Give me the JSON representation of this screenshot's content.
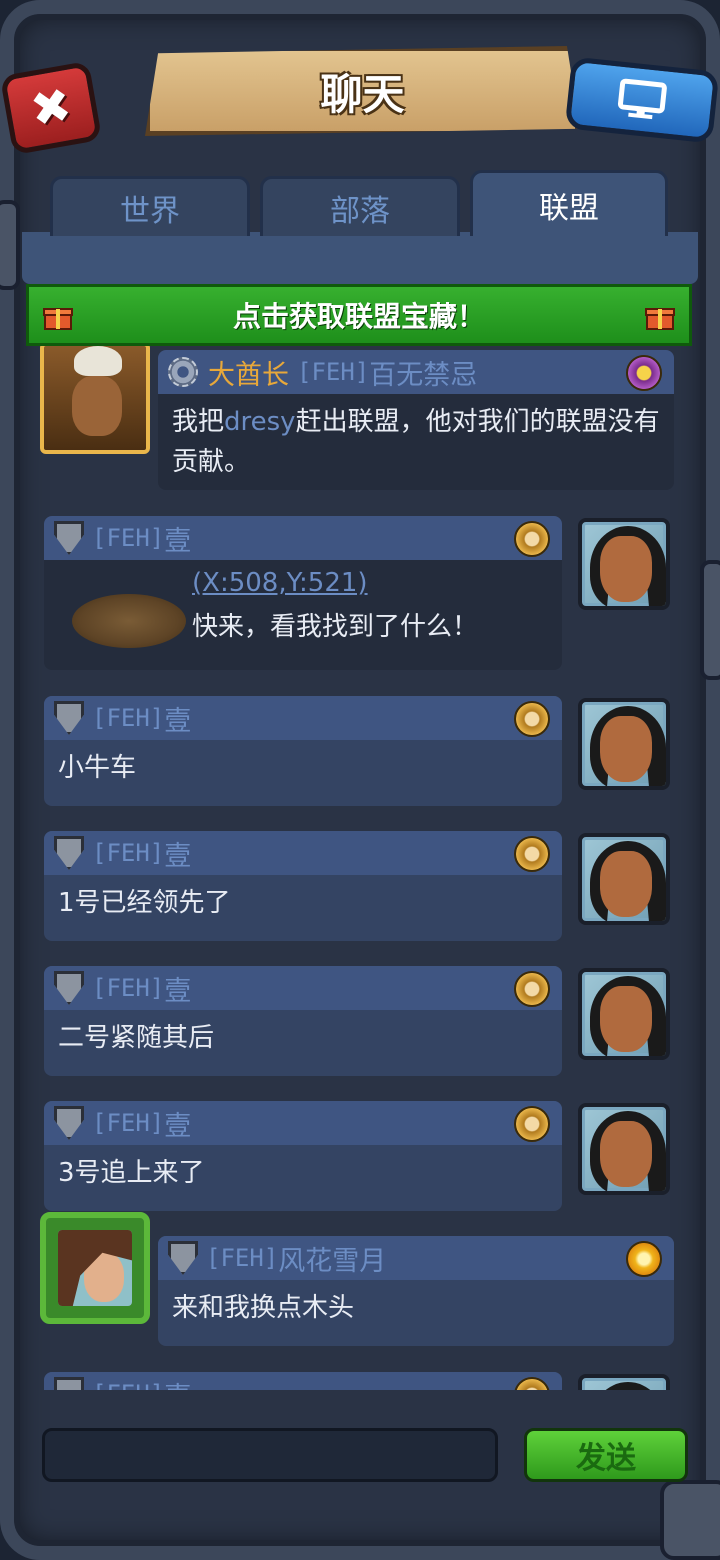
{
  "header": {
    "title": "聊天",
    "close_icon": "close-icon",
    "screen_icon": "monitor-icon"
  },
  "tabs": [
    {
      "label": "世界",
      "active": false
    },
    {
      "label": "部落",
      "active": false
    },
    {
      "label": "联盟",
      "active": true
    }
  ],
  "treasure_banner": {
    "text": "点击获取联盟宝藏！",
    "icon": "gift-icon"
  },
  "messages": [
    {
      "role": "大酋长",
      "tag": "[FEH]",
      "name": "百无禁忌",
      "text_before": "我把",
      "highlight": "dresy",
      "text_after": "赶出联盟，他对我们的联盟没有贡献。"
    },
    {
      "tag": "[FEH]",
      "name": "壹",
      "coord": "(X:508,Y:521)",
      "text": "快来，看我找到了什么！"
    },
    {
      "tag": "[FEH]",
      "name": "壹",
      "text": "小牛车"
    },
    {
      "tag": "[FEH]",
      "name": "壹",
      "text": "1号已经领先了"
    },
    {
      "tag": "[FEH]",
      "name": "壹",
      "text": "二号紧随其后"
    },
    {
      "tag": "[FEH]",
      "name": "壹",
      "text": "3号追上来了"
    },
    {
      "tag": "[FEH]",
      "name": "风花雪月",
      "text": "来和我换点木头"
    },
    {
      "tag": "[FEH]",
      "name": "壹",
      "text": ""
    }
  ],
  "composer": {
    "placeholder": "",
    "send_label": "发送"
  },
  "colors": {
    "accent_green": "#2f9a1c",
    "chief_orange": "#e8a83a",
    "name_blue": "#6c8dc4"
  }
}
